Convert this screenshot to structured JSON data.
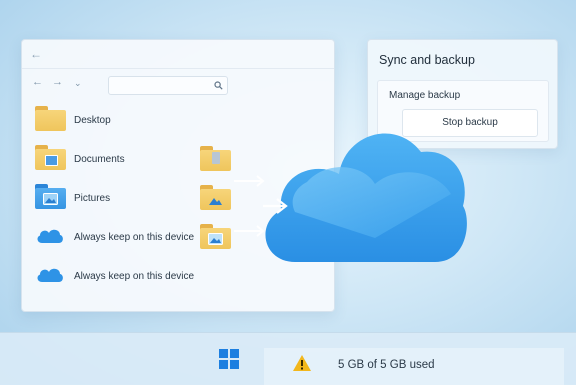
{
  "explorer": {
    "items": [
      {
        "label": "Desktop",
        "icon": "folder-icon"
      },
      {
        "label": "Documents",
        "icon": "documents-folder-icon"
      },
      {
        "label": "Pictures",
        "icon": "pictures-folder-icon"
      },
      {
        "label": "Always keep on this device",
        "icon": "cloud-icon"
      },
      {
        "label": "Always keep on this device",
        "icon": "cloud-icon"
      }
    ]
  },
  "sync": {
    "title": "Sync and backup",
    "manage_label": "Manage backup",
    "stop_button": "Stop backup"
  },
  "taskbar": {
    "storage_text": "5 GB of 5 GB used"
  },
  "colors": {
    "accent": "#1c7fe0",
    "folder": "#f2c95f",
    "cloud": "#3fa3ec",
    "warning": "#f2b71c"
  }
}
